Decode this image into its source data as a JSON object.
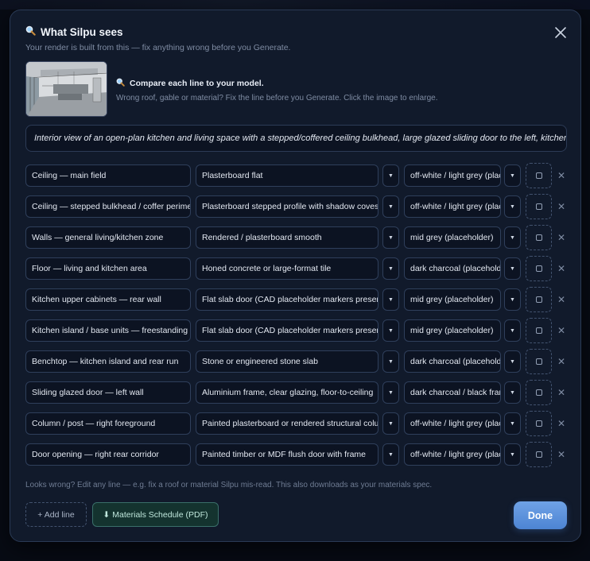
{
  "header": {
    "title_icon": "magnifier-icon",
    "title": "What Silpu sees",
    "subtitle": "Your render is built from this — fix anything wrong before you Generate."
  },
  "compare": {
    "icon": "magnifier-icon",
    "heading": "Compare each line to your model.",
    "hint": "Wrong roof, gable or material? Fix the line before you Generate. Click the image to enlarge."
  },
  "description": "Interior view of an open-plan kitchen and living space with a stepped/coffered ceiling bulkhead, large glazed sliding door to the left, kitchen island and rear cabinetry.",
  "rows": [
    {
      "element": "Ceiling — main field",
      "material": "Plasterboard flat",
      "colour": "off-white / light grey (placeholder)"
    },
    {
      "element": "Ceiling — stepped bulkhead / coffer perimeter",
      "material": "Plasterboard stepped profile with shadow coves",
      "colour": "off-white / light grey (placeholder)"
    },
    {
      "element": "Walls — general living/kitchen zone",
      "material": "Rendered / plasterboard smooth",
      "colour": "mid grey (placeholder)"
    },
    {
      "element": "Floor — living and kitchen area",
      "material": "Honed concrete or large-format tile",
      "colour": "dark charcoal (placeholder)"
    },
    {
      "element": "Kitchen upper cabinets — rear wall",
      "material": "Flat slab door (CAD placeholder markers present)",
      "colour": "mid grey (placeholder)"
    },
    {
      "element": "Kitchen island / base units — freestanding",
      "material": "Flat slab door (CAD placeholder markers present)",
      "colour": "mid grey (placeholder)"
    },
    {
      "element": "Benchtop — kitchen island and rear run",
      "material": "Stone or engineered stone slab",
      "colour": "dark charcoal (placeholder)"
    },
    {
      "element": "Sliding glazed door — left wall",
      "material": "Aluminium frame, clear glazing, floor-to-ceiling",
      "colour": "dark charcoal / black frame"
    },
    {
      "element": "Column / post — right foreground",
      "material": "Painted plasterboard or rendered structural column",
      "colour": "off-white / light grey (placeholder)"
    },
    {
      "element": "Door opening — right rear corridor",
      "material": "Painted timber or MDF flush door with frame",
      "colour": "off-white / light grey (placeholder)"
    }
  ],
  "row_icons": {
    "select": "caret-down-icon",
    "remove": "close-icon",
    "swatch": "swatch-checkbox-icon"
  },
  "footer": {
    "note": "Looks wrong? Edit any line — e.g. fix a roof or material Silpu mis-read. This also downloads as your materials spec.",
    "add_line": "+ Add line",
    "pdf_icon": "download-arrow-icon",
    "pdf": "Materials Schedule (PDF)",
    "done": "Done"
  },
  "colors": {
    "accent": "#5b8fdc",
    "modal_bg": "#111a2b",
    "pdf_bg": "#14332f"
  }
}
